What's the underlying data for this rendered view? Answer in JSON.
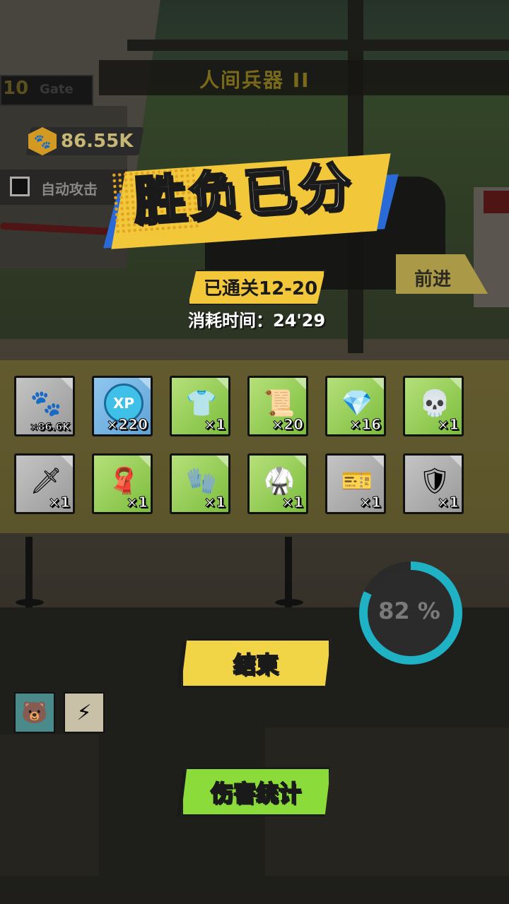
{
  "hud": {
    "coins": "86.55K",
    "gate_label": "Gate",
    "auto_attack_label": "自动攻击",
    "forward_label": "前进",
    "stage_banner_title": "人间兵器 II"
  },
  "result": {
    "title": "胜负已分",
    "stage_cleared": "已通关12-20",
    "time_used": "消耗时间：24'29"
  },
  "rewards": [
    {
      "name": "paw-coin",
      "qty": "×86.6K",
      "bg": "gray",
      "icon": "paw-coin-icon"
    },
    {
      "name": "xp-orb",
      "qty": "×220",
      "bg": "blue",
      "icon": "xp-icon"
    },
    {
      "name": "sailor-top",
      "qty": "×1",
      "bg": "green",
      "icon": "sailor-shirt-icon"
    },
    {
      "name": "scroll",
      "qty": "×20",
      "bg": "green",
      "icon": "scroll-icon"
    },
    {
      "name": "purple-gem",
      "qty": "×16",
      "bg": "green",
      "icon": "gem-icon"
    },
    {
      "name": "skull-mask",
      "qty": "×1",
      "bg": "green",
      "icon": "mask-icon"
    },
    {
      "name": "blade",
      "qty": "×1",
      "bg": "gray",
      "icon": "blade-icon"
    },
    {
      "name": "red-scarf",
      "qty": "×1",
      "bg": "green",
      "icon": "scarf-icon"
    },
    {
      "name": "blue-gloves",
      "qty": "×1",
      "bg": "green",
      "icon": "glove-icon"
    },
    {
      "name": "karate-gi",
      "qty": "×1",
      "bg": "green",
      "icon": "gi-icon"
    },
    {
      "name": "blue-ticket",
      "qty": "×1",
      "bg": "gray",
      "icon": "ticket-icon"
    },
    {
      "name": "red-armor",
      "qty": "×1",
      "bg": "gray",
      "icon": "armor-icon"
    }
  ],
  "progress": {
    "value": 0.82,
    "label": "82 %"
  },
  "buttons": {
    "end": "结束",
    "damage_stats": "伤害统计"
  },
  "colors": {
    "ring": "#1fb1c4",
    "end_button": "#f2d447",
    "damage_button": "#8bdc3b",
    "banner": "#f2c73a"
  }
}
